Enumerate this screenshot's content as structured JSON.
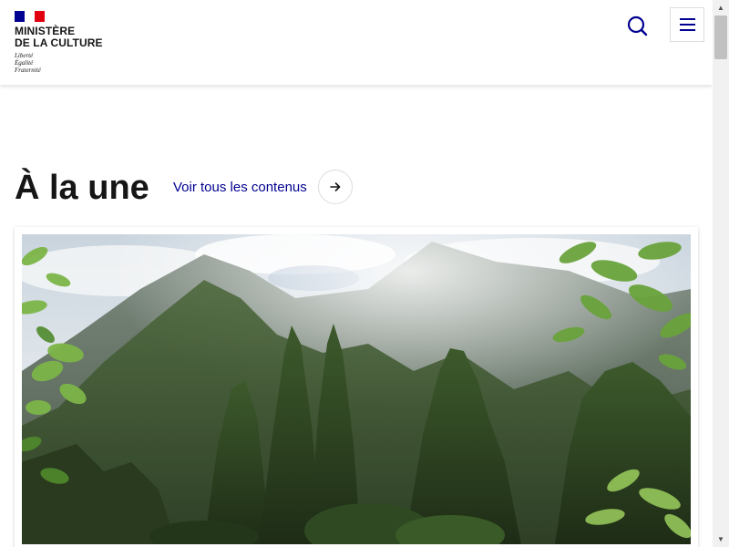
{
  "header": {
    "ministry_line1": "MINISTÈRE",
    "ministry_line2": "DE LA CULTURE",
    "motto": [
      "Liberté",
      "Égalité",
      "Fraternité"
    ],
    "search_icon": "search-icon",
    "menu_icon": "hamburger-menu-icon",
    "flag_colors": [
      "#000091",
      "#ffffff",
      "#e1000f"
    ]
  },
  "section": {
    "title": "À la une",
    "see_all_label": "Voir tous les contenus",
    "see_all_icon": "arrow-right-icon"
  },
  "featured": {
    "image_subject": "photo of jagged green volcanic mountain peaks under a cloudy sky, framed by tropical leaves"
  },
  "colors": {
    "accent": "#000091",
    "text": "#161616",
    "brand_red": "#e1000f"
  }
}
